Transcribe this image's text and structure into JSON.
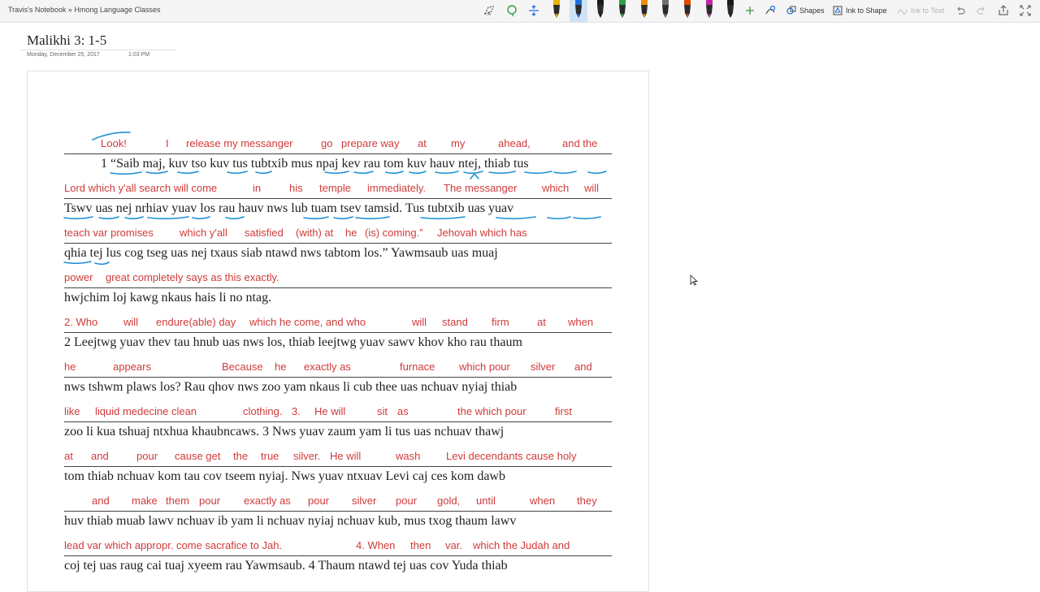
{
  "app": {
    "breadcrumb": "Travis's Notebook » Hmong Language Classes"
  },
  "toolbar": {
    "shapes_label": "Shapes",
    "ink_to_shape_label": "Ink to Shape",
    "ink_to_text_label": "Ink to Text",
    "pen_colors": [
      "#e8b400",
      "#1e6fd9",
      "#1a1a1a",
      "#2ea043",
      "#f28c00",
      "#6e6e6e",
      "#e04a00",
      "#c026a8",
      "#1a1a1a"
    ],
    "active_pen_index": 1
  },
  "page": {
    "title": "Malikhi 3: 1-5",
    "date": "Monday, December 25, 2017",
    "time": "1:03 PM"
  },
  "document": {
    "ink_color": "#1e90d6",
    "gloss_color": "#d03a3a",
    "lines": [
      {
        "gloss": [
          "Look!",
          "I",
          "release my messanger",
          "go",
          "prepare way",
          "at",
          "my",
          "ahead,",
          "and the"
        ],
        "text": "1 “Saib maj, kuv tso kuv tus tubtxib mus npaj kev rau tom kuv hauv ntej, thiab tus"
      },
      {
        "gloss": [
          "Lord which y'all search will come",
          "in",
          "his",
          "temple",
          "immediately.",
          "The messanger",
          "which",
          "will"
        ],
        "text": "Tswv uas nej nrhiav yuav los rau hauv nws lub tuam tsev tamsid. Tus tubtxib uas yuav"
      },
      {
        "gloss": [
          "teach var promises",
          "which y'all",
          "satisfied",
          "(with) at",
          "he",
          "(is) coming.”",
          "Jehovah which has"
        ],
        "text": "qhia tej lus cog tseg uas nej txaus siab ntawd nws tabtom los.” Yawmsaub uas muaj"
      },
      {
        "gloss": [
          "power",
          "great completely says as this exactly."
        ],
        "text": "hwjchim loj kawg nkaus hais li no ntag."
      },
      {
        "gloss": [
          "2. Who",
          "will",
          "endure(able) day",
          "which he come, and who",
          "will",
          "stand",
          "firm",
          "at",
          "when"
        ],
        "text": "2 Leejtwg yuav thev tau hnub uas nws los, thiab leejtwg yuav sawv khov kho rau thaum"
      },
      {
        "gloss": [
          "he",
          "appears",
          "Because",
          "he",
          "exactly as",
          "furnace",
          "which pour",
          "silver",
          "and"
        ],
        "text": "nws tshwm plaws los? Rau qhov nws zoo yam nkaus li cub thee uas nchuav nyiaj thiab"
      },
      {
        "gloss": [
          "like",
          "liquid medecine clean",
          "clothing.",
          "3.",
          "He will",
          "sit",
          "as",
          "the which pour",
          "first"
        ],
        "text": "zoo li kua tshuaj ntxhua khaubncaws. 3 Nws yuav zaum yam li tus uas nchuav thawj"
      },
      {
        "gloss": [
          "at",
          "and",
          "pour",
          "cause get",
          "the",
          "true",
          "silver.",
          "He will",
          "wash",
          "Levi decendants cause holy"
        ],
        "text": "tom thiab nchuav kom tau cov tseem nyiaj. Nws yuav ntxuav Levi caj ces kom dawb"
      },
      {
        "gloss": [
          "and",
          "make",
          "them",
          "pour",
          "exactly as",
          "pour",
          "silver",
          "pour",
          "gold,",
          "until",
          "when",
          "they"
        ],
        "text": "huv thiab muab lawv nchuav ib yam li nchuav nyiaj nchuav kub, mus txog thaum lawv"
      },
      {
        "gloss": [
          "lead var which appropr. come sacrafice to Jah.",
          "4. When",
          "then",
          "var.",
          "which the Judah and"
        ],
        "text": "coj tej uas raug cai tuaj xyeem rau Yawmsaub. 4 Thaum ntawd tej uas cov Yuda thiab"
      }
    ]
  }
}
